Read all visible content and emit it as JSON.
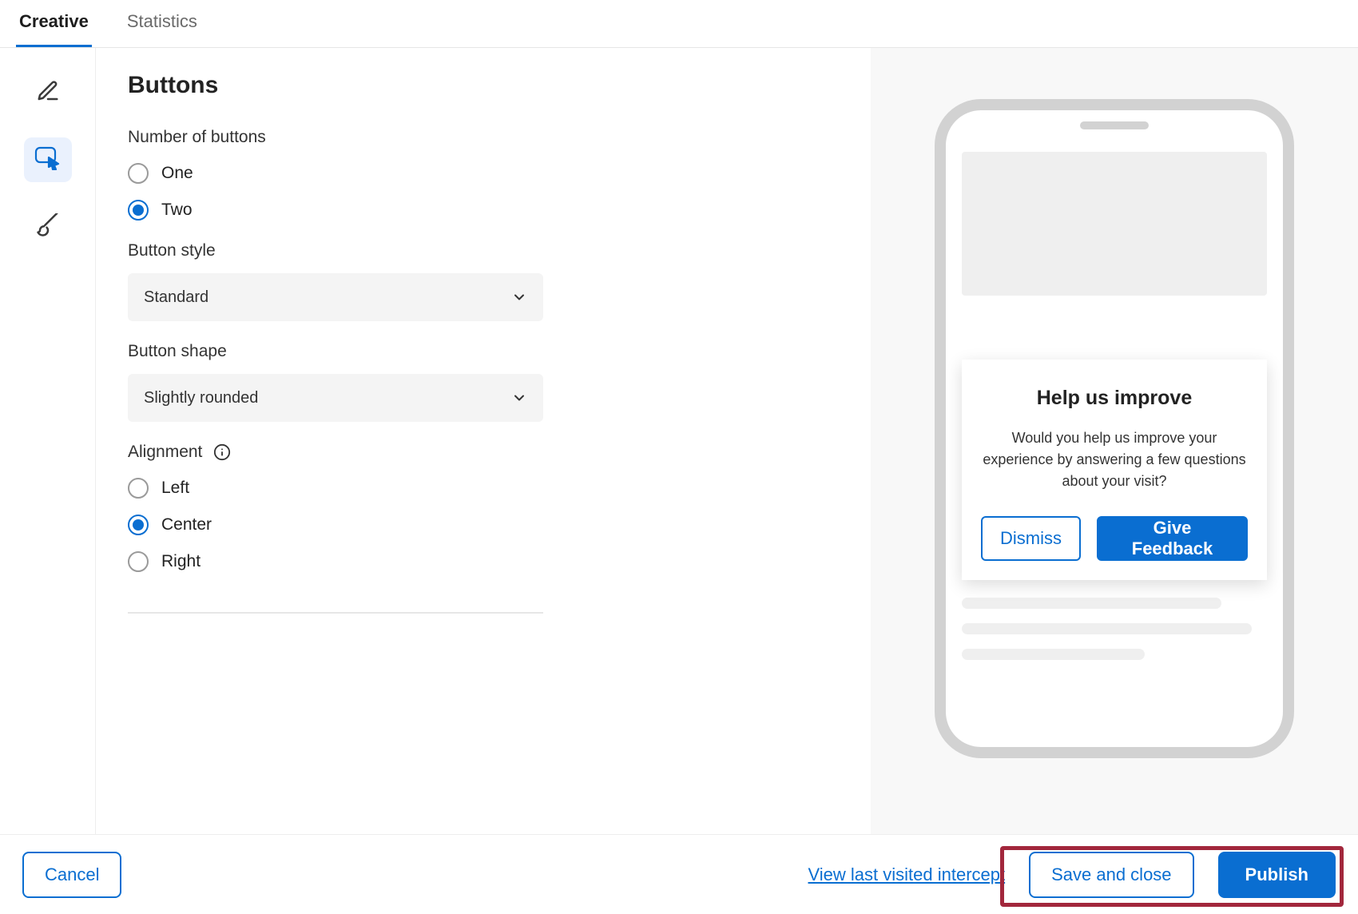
{
  "tabs": {
    "creative": "Creative",
    "statistics": "Statistics"
  },
  "rail": {
    "edit_icon": "edit-icon",
    "cursor_icon": "cursor-icon",
    "brush_icon": "brush-icon"
  },
  "panel": {
    "title": "Buttons",
    "number_label": "Number of buttons",
    "radio_one": "One",
    "radio_two": "Two",
    "style_label": "Button style",
    "style_value": "Standard",
    "shape_label": "Button shape",
    "shape_value": "Slightly rounded",
    "alignment_label": "Alignment",
    "align_left": "Left",
    "align_center": "Center",
    "align_right": "Right"
  },
  "preview": {
    "modal_title": "Help us improve",
    "modal_body": "Would you help us improve your experience by answering a few questions about your visit?",
    "dismiss": "Dismiss",
    "feedback": "Give Feedback"
  },
  "footer": {
    "cancel": "Cancel",
    "view_link": "View last visited intercept",
    "save": "Save and close",
    "publish": "Publish"
  }
}
